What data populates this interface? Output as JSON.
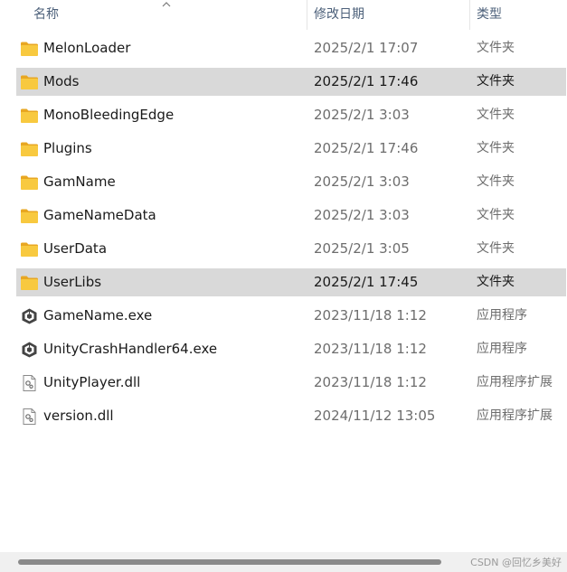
{
  "columns": {
    "name": "名称",
    "date": "修改日期",
    "type": "类型"
  },
  "files": [
    {
      "name": "MelonLoader",
      "date": "2025/2/1 17:07",
      "type": "文件夹",
      "icon": "folder-icon",
      "selected": false
    },
    {
      "name": "Mods",
      "date": "2025/2/1 17:46",
      "type": "文件夹",
      "icon": "folder-icon",
      "selected": true
    },
    {
      "name": "MonoBleedingEdge",
      "date": "2025/2/1 3:03",
      "type": "文件夹",
      "icon": "folder-icon",
      "selected": false
    },
    {
      "name": "Plugins",
      "date": "2025/2/1 17:46",
      "type": "文件夹",
      "icon": "folder-icon",
      "selected": false
    },
    {
      "name": "GamName",
      "date": "2025/2/1 3:03",
      "type": "文件夹",
      "icon": "folder-icon",
      "selected": false
    },
    {
      "name": "GameNameData",
      "date": "2025/2/1 3:03",
      "type": "文件夹",
      "icon": "folder-icon",
      "selected": false
    },
    {
      "name": "UserData",
      "date": "2025/2/1 3:05",
      "type": "文件夹",
      "icon": "folder-icon",
      "selected": false
    },
    {
      "name": "UserLibs",
      "date": "2025/2/1 17:45",
      "type": "文件夹",
      "icon": "folder-icon",
      "selected": true
    },
    {
      "name": "GameName.exe",
      "date": "2023/11/18 1:12",
      "type": "应用程序",
      "icon": "unity-exe-icon",
      "selected": false
    },
    {
      "name": "UnityCrashHandler64.exe",
      "date": "2023/11/18 1:12",
      "type": "应用程序",
      "icon": "unity-exe-icon",
      "selected": false
    },
    {
      "name": "UnityPlayer.dll",
      "date": "2023/11/18 1:12",
      "type": "应用程序扩展",
      "icon": "dll-file-icon",
      "selected": false
    },
    {
      "name": "version.dll",
      "date": "2024/11/12 13:05",
      "type": "应用程序扩展",
      "icon": "dll-file-icon",
      "selected": false
    }
  ],
  "watermark": "CSDN @回忆乡美好",
  "colors": {
    "selection": "#d9d9d9",
    "folder": "#f8c93f",
    "header_text": "#4c607a"
  }
}
